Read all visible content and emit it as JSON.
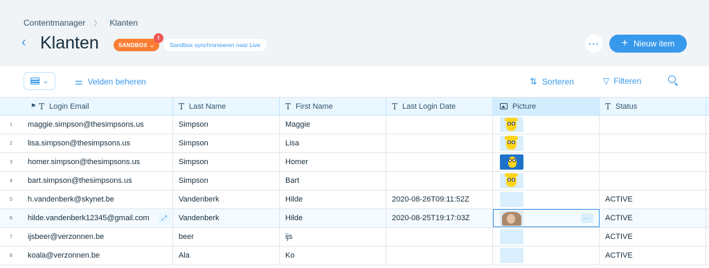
{
  "breadcrumb": {
    "root": "Contentmanager",
    "current": "Klanten"
  },
  "header": {
    "title": "Klanten",
    "sandbox_label": "SANDBOX",
    "notification_count": "!",
    "sync_label": "Sandbox synchroniseren naar Live",
    "new_item_label": "Nieuw item"
  },
  "toolbar": {
    "fields_label": "Velden beheren",
    "sort_label": "Sorteren",
    "filter_label": "Filteren"
  },
  "columns": {
    "email": "Login Email",
    "last": "Last Name",
    "first": "First Name",
    "date": "Last Login Date",
    "picture": "Picture",
    "status": "Status"
  },
  "rows": [
    {
      "index": "1",
      "email": "maggie.simpson@thesimpsons.us",
      "last": "Simpson",
      "first": "Maggie",
      "date": "",
      "status": "",
      "picture": "maggie"
    },
    {
      "index": "2",
      "email": "lisa.simpson@thesimpsons.us",
      "last": "Simpson",
      "first": "Lisa",
      "date": "",
      "status": "",
      "picture": "lisa"
    },
    {
      "index": "3",
      "email": "homer.simpson@thesimpsons.us",
      "last": "Simpson",
      "first": "Homer",
      "date": "",
      "status": "",
      "picture": "homer"
    },
    {
      "index": "4",
      "email": "bart.simpson@thesimpsons.us",
      "last": "Simpson",
      "first": "Bart",
      "date": "",
      "status": "",
      "picture": "bart"
    },
    {
      "index": "5",
      "email": "h.vandenberk@skynet.be",
      "last": "Vandenberk",
      "first": "Hilde",
      "date": "2020-08-26T09:11:52Z",
      "status": "ACTIVE",
      "picture": "empty"
    },
    {
      "index": "6",
      "email": "hilde.vandenberk12345@gmail.com",
      "last": "Vandenberk",
      "first": "Hilde",
      "date": "2020-08-25T19:17:03Z",
      "status": "ACTIVE",
      "picture": "photo"
    },
    {
      "index": "7",
      "email": "ijsbeer@verzonnen.be",
      "last": "beer",
      "first": "ijs",
      "date": "",
      "status": "ACTIVE",
      "picture": "empty"
    },
    {
      "index": "8",
      "email": "koala@verzonnen.be",
      "last": "Ala",
      "first": "Ko",
      "date": "",
      "status": "ACTIVE",
      "picture": "empty"
    }
  ],
  "colors": {
    "accent": "#3899ec",
    "sandbox": "#fb7d33",
    "notification": "#ee5951",
    "header_bg": "#f0f4f7"
  }
}
